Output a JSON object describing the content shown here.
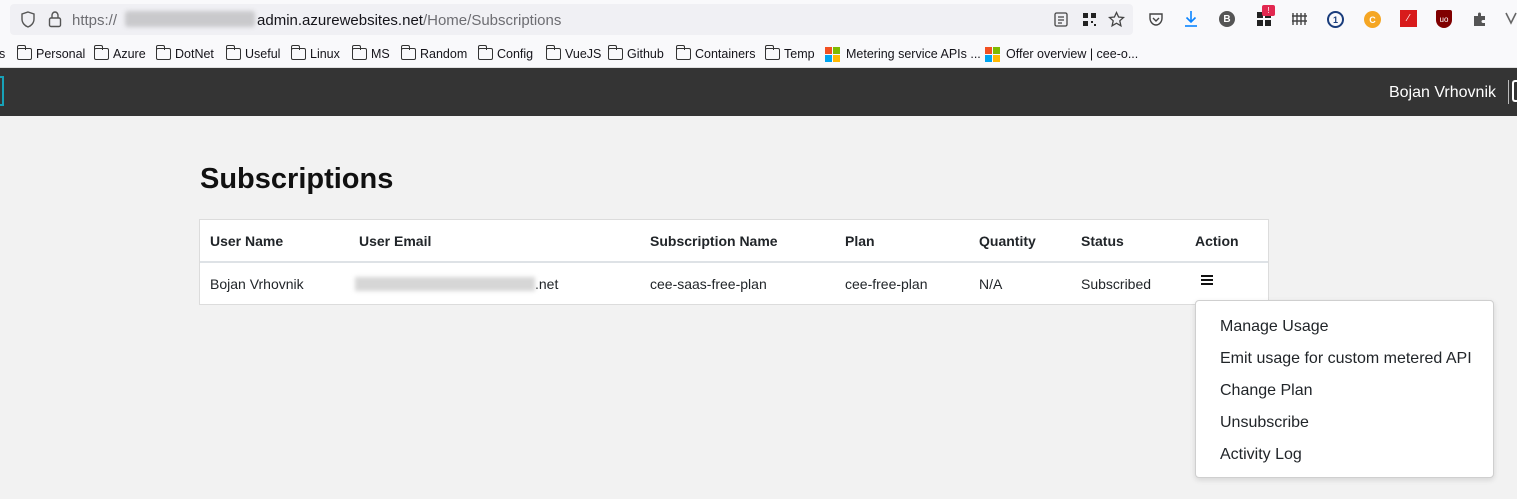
{
  "browser": {
    "url_scheme": "https://",
    "url_host": "admin.azurewebsites.net",
    "url_path": "/Home/Subscriptions",
    "ext_badge": "!"
  },
  "bookmarks": [
    {
      "label": "Personal",
      "type": "folder"
    },
    {
      "label": "Azure",
      "type": "folder"
    },
    {
      "label": "DotNet",
      "type": "folder"
    },
    {
      "label": "Useful",
      "type": "folder"
    },
    {
      "label": "Linux",
      "type": "folder"
    },
    {
      "label": "MS",
      "type": "folder"
    },
    {
      "label": "Random",
      "type": "folder"
    },
    {
      "label": "Config",
      "type": "folder"
    },
    {
      "label": "VueJS",
      "type": "folder"
    },
    {
      "label": "Github",
      "type": "folder"
    },
    {
      "label": "Containers",
      "type": "folder"
    },
    {
      "label": "Temp",
      "type": "folder"
    },
    {
      "label": "Metering service APIs ...",
      "type": "ms"
    },
    {
      "label": "Offer overview | cee-o...",
      "type": "ms"
    }
  ],
  "navbar": {
    "user_name": "Bojan Vrhovnik"
  },
  "main": {
    "title": "Subscriptions",
    "table": {
      "headers": [
        "User Name",
        "User Email",
        "Subscription Name",
        "Plan",
        "Quantity",
        "Status",
        "Action"
      ],
      "rows": [
        {
          "user_name": "Bojan Vrhovnik",
          "user_email_suffix": ".net",
          "subscription_name": "cee-saas-free-plan",
          "plan": "cee-free-plan",
          "quantity": "N/A",
          "status": "Subscribed"
        }
      ]
    }
  },
  "action_menu": {
    "items": [
      "Manage Usage",
      "Emit usage for custom metered API",
      "Change Plan",
      "Unsubscribe",
      "Activity Log"
    ]
  },
  "colors": {
    "navbar_bg": "#343434",
    "page_bg": "#f2f2f2",
    "brand_accent": "#17a2b8"
  }
}
